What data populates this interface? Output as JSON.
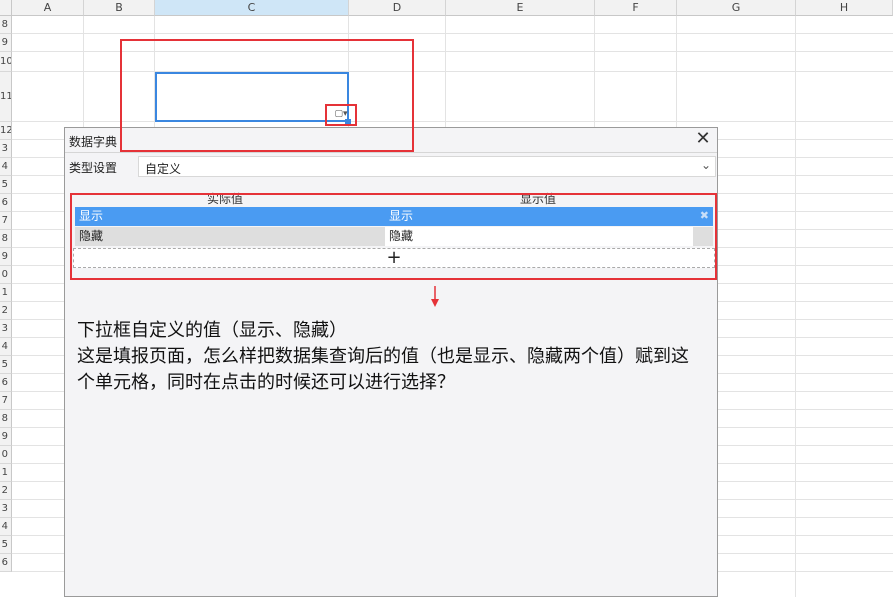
{
  "spreadsheet": {
    "columns": [
      "A",
      "B",
      "C",
      "D",
      "E",
      "F",
      "G",
      "H"
    ],
    "selected_column": "C",
    "rows": [
      "8",
      "9",
      "10",
      "11",
      "12",
      "3",
      "4",
      "5",
      "6",
      "7",
      "8",
      "9",
      "0",
      "1",
      "2",
      "3",
      "4",
      "5",
      "6",
      "7",
      "8",
      "9",
      "0",
      "1",
      "2",
      "3",
      "4",
      "5",
      "6"
    ]
  },
  "cell": {
    "dropdown_icon": "dropdown-handle-icon",
    "dropdown_glyph": "▢▾"
  },
  "dialog": {
    "title": "数据字典",
    "close_glyph": "✕",
    "type_label": "类型设置",
    "type_value": "自定义",
    "select_arrow": "⌄",
    "columns": {
      "actual": "实际值",
      "display": "显示值"
    },
    "rows": [
      {
        "actual": "显示",
        "display": "显示",
        "delete_glyph": "✖"
      },
      {
        "actual": "隐藏",
        "display": "隐藏"
      }
    ],
    "add_glyph": "+"
  },
  "annotation": {
    "text": "下拉框自定义的值（显示、隐藏）\n这是填报页面，怎么样把数据集查询后的值（也是显示、隐藏两个值）赋到这个单元格，同时在点击的时候还可以进行选择？"
  },
  "colors": {
    "highlight_red": "#e53238",
    "row_selected": "#4a9bf2",
    "cell_border": "#3a87e0"
  }
}
